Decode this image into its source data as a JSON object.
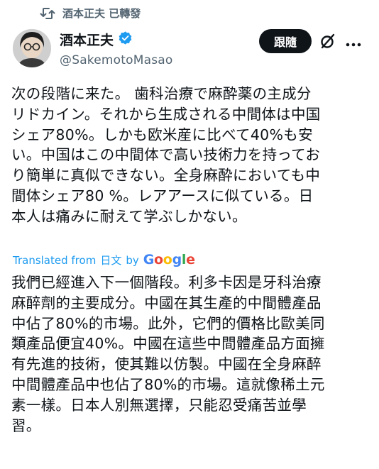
{
  "repost": {
    "label": "酒本正夫 已轉發",
    "icon": "repost-icon"
  },
  "author": {
    "display_name": "酒本正夫",
    "handle": "@SakemotoMasao",
    "verified": true,
    "verified_color": "#1d9bf0"
  },
  "actions": {
    "follow_label": "跟隨",
    "grok_icon": "grok-icon",
    "more_icon": "more-options-icon"
  },
  "tweet": {
    "text": "次の段階に来た。 歯科治療で麻酔薬の主成分\nリドカイン。それから生成される中間体は中国\nシェア80%。しかも欧米産に比べて40%も安\nい。中国はこの中間体で高い技術力を持ってお\nり簡単に真似できない。全身麻酔においても中\n間体シェア80 %。レアアースに似ている。日\n本人は痛みに耐えて学ぶしかない。"
  },
  "translation": {
    "prefix": "Translated from",
    "language": "日文",
    "by": "by",
    "provider": "Google",
    "text": "我們已經進入下一個階段。利多卡因是牙科治療\n麻醉劑的主要成分。中國在其生產的中間體產品\n中佔了80%的市場。此外，它們的價格比歐美同\n類產品便宜40%。中國在這些中間體產品方面擁\n有先進的技術，使其難以仿製。中國在全身麻醉\n中間體產品中也佔了80%的市場。這就像稀土元\n素一樣。日本人別無選擇，只能忍受痛苦並學\n習。"
  },
  "colors": {
    "text": "#0f1419",
    "secondary": "#536471",
    "link": "#1d9bf0",
    "button_bg": "#0f1419"
  }
}
